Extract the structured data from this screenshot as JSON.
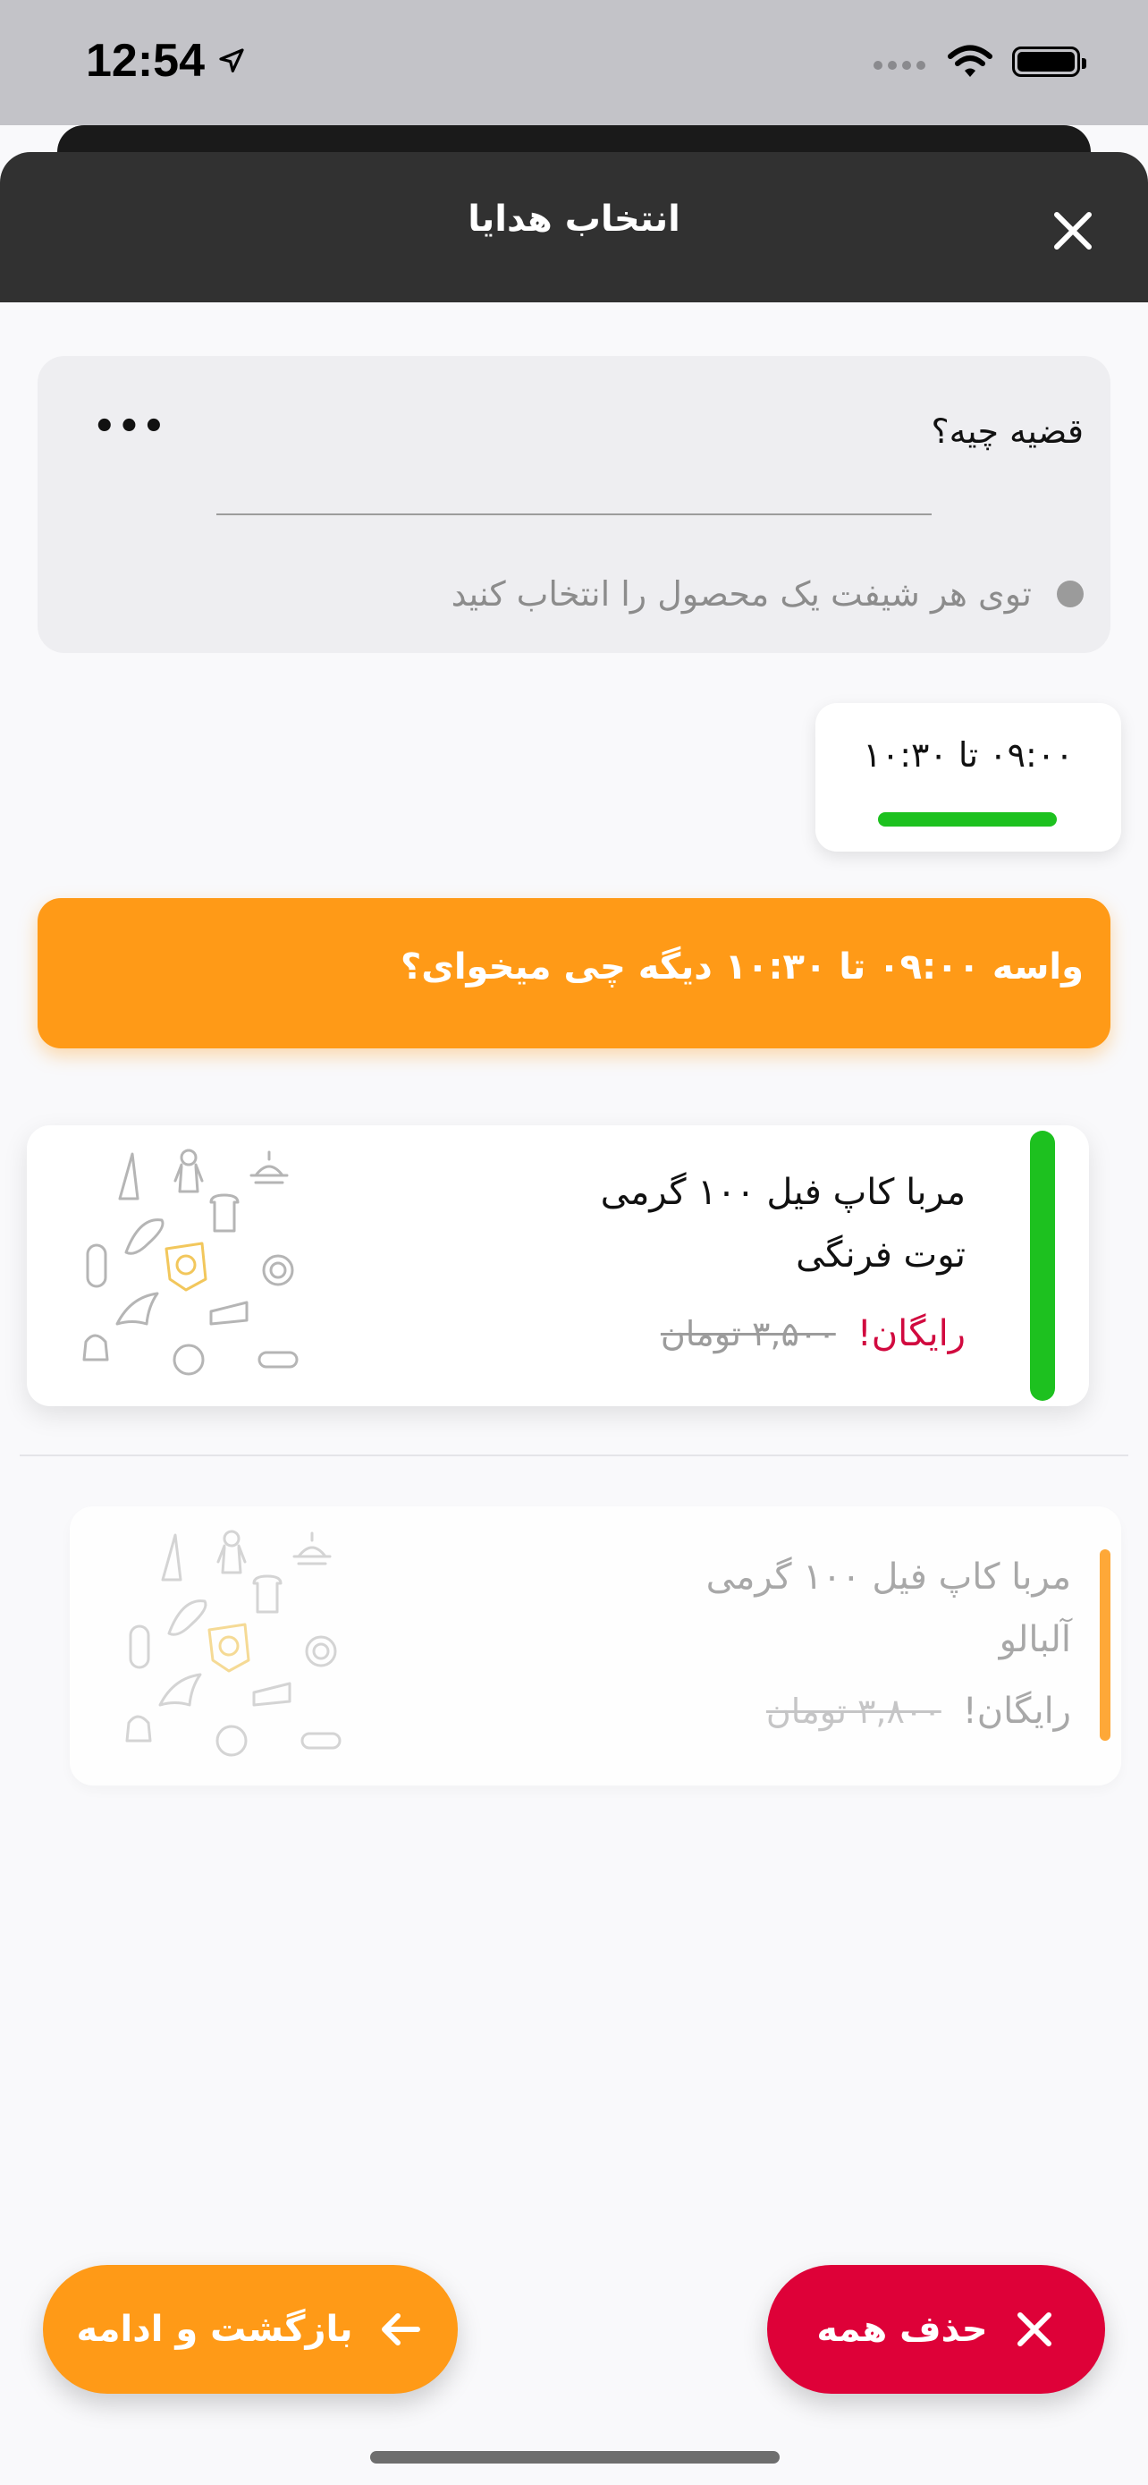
{
  "status_bar": {
    "time": "12:54"
  },
  "header": {
    "title": "انتخاب هدایا"
  },
  "info": {
    "title": "قضیه چیه؟",
    "more": "•••",
    "bullet": "توی هر شیفت یک محصول را انتخاب کنید"
  },
  "shift": {
    "label": "۰۹:۰۰ تا ۱۰:۳۰"
  },
  "banner": {
    "text": "واسه ۰۹:۰۰ تا ۱۰:۳۰ دیگه چی میخوای؟"
  },
  "products": [
    {
      "name_line1": "مربا کاپ فیل ۱۰۰ گرمی",
      "name_line2": "توت فرنگی",
      "old_price": "۳,۵۰۰ تومان",
      "free": "رایگان!",
      "status_color": "#1DC11F"
    },
    {
      "name_line1": "مربا کاپ فیل ۱۰۰ گرمی",
      "name_line2": "آلبالو",
      "old_price": "۳,۸۰۰ تومان",
      "free": "رایگان!",
      "status_color": "#FF9A17"
    }
  ],
  "buttons": {
    "back_continue": "بازگشت و ادامه",
    "delete_all": "حذف همه"
  },
  "colors": {
    "accent_orange": "#FF9A17",
    "accent_red": "#DE0138",
    "selected_green": "#1DC11F",
    "header_dark": "#313131"
  },
  "icons": {
    "close": "close-icon",
    "arrow": "arrow-left-icon",
    "location": "location-arrow-icon"
  }
}
